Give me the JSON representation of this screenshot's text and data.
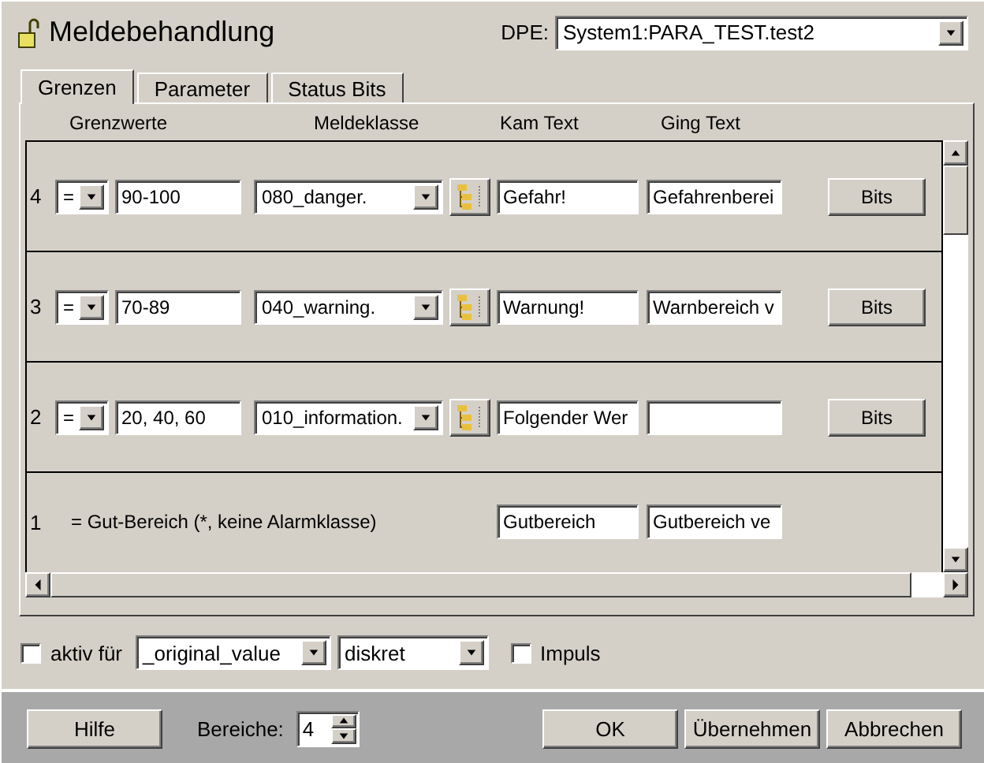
{
  "window": {
    "title": "Meldebehandlung"
  },
  "dpe": {
    "label": "DPE:",
    "value": "System1:PARA_TEST.test2"
  },
  "tabs": [
    {
      "label": "Grenzen",
      "selected": true
    },
    {
      "label": "Parameter",
      "selected": false
    },
    {
      "label": "Status Bits",
      "selected": false
    }
  ],
  "columns": [
    "Grenzwerte",
    "Meldeklasse",
    "Kam Text",
    "Ging Text"
  ],
  "limits": [
    {
      "kind": "range",
      "index": "4",
      "operator": "=",
      "value": "90-100",
      "class": "080_danger.",
      "came_text": "Gefahr!",
      "went_text": "Gefahrenberei",
      "button": "Bits"
    },
    {
      "kind": "range",
      "index": "3",
      "operator": "=",
      "value": "70-89",
      "class": "040_warning.",
      "came_text": "Warnung!",
      "went_text": "Warnbereich v",
      "button": "Bits"
    },
    {
      "kind": "range",
      "index": "2",
      "operator": "=",
      "value": "20, 40, 60",
      "class": "010_information.",
      "came_text": "Folgender Wer",
      "button": "Bits"
    },
    {
      "kind": "good",
      "index": "1",
      "description": "= Gut-Bereich (*, keine Alarmklasse)",
      "came_text": "Gutbereich",
      "went_text": "Gutbereich ve"
    }
  ],
  "options": {
    "active": {
      "label": "aktiv für",
      "checked": false
    },
    "attribute": "_original_value",
    "mode": "diskret",
    "impulse": {
      "label": "Impuls",
      "checked": false
    }
  },
  "footer": {
    "help": "Hilfe",
    "ranges_label": "Bereiche:",
    "ranges": "4",
    "buttons": [
      "OK",
      "Übernehmen",
      "Abbrechen"
    ]
  }
}
